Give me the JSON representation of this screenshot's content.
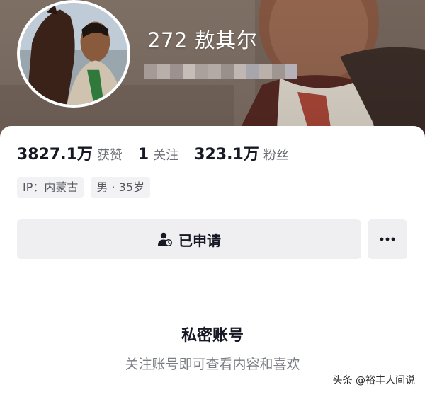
{
  "profile": {
    "nickname": "272 敖其尔"
  },
  "stats": [
    {
      "value": "3827.1万",
      "label": "获赞"
    },
    {
      "value": "1",
      "label": "关注"
    },
    {
      "value": "323.1万",
      "label": "粉丝"
    }
  ],
  "tags": [
    {
      "text": "IP：内蒙古"
    },
    {
      "text": "男 · 35岁"
    }
  ],
  "actions": {
    "applied_label": "已申请",
    "applied_icon": "user-clock-icon",
    "more_icon": "more-dots-icon"
  },
  "private_notice": {
    "title": "私密账号",
    "description": "关注账号即可查看内容和喜欢"
  },
  "watermark": {
    "text": "头条 @裕丰人间说"
  },
  "colors": {
    "button_bg": "#efeff1",
    "tag_bg": "#f2f2f4",
    "primary_text": "#161823",
    "secondary_text": "#7b7d84"
  }
}
